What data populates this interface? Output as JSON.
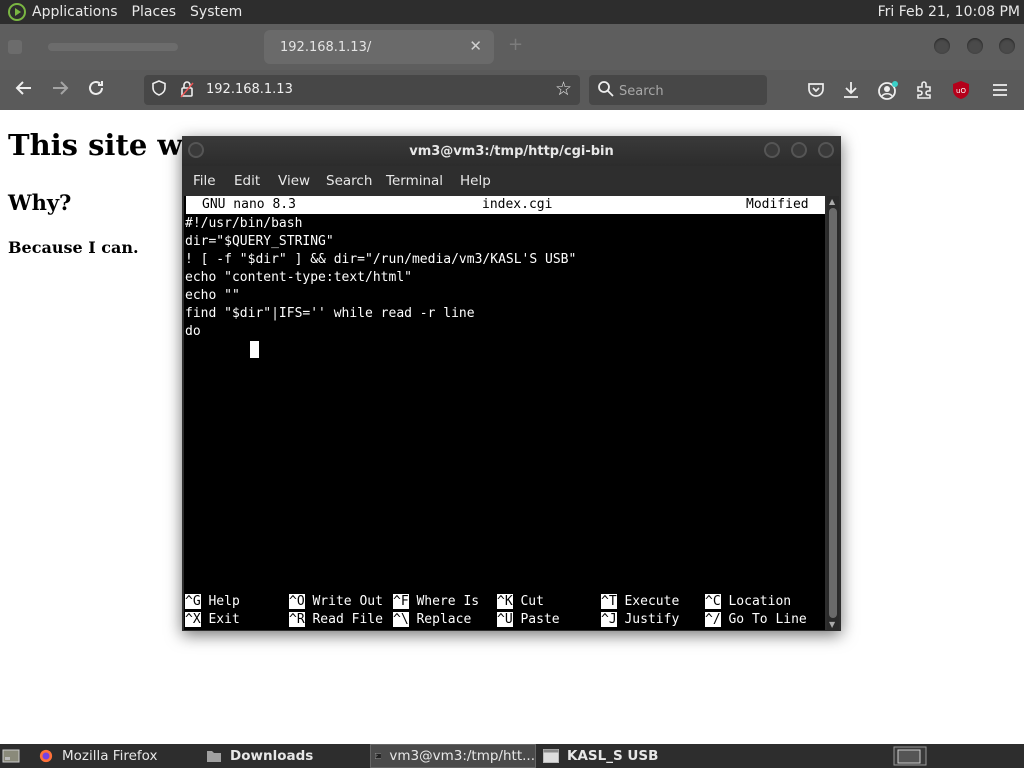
{
  "top_panel": {
    "menus": [
      "Applications",
      "Places",
      "System"
    ],
    "clock": "Fri Feb 21, 10:08 PM"
  },
  "browser": {
    "active_tab": {
      "title": "192.168.1.13/",
      "close": "✕"
    },
    "new_tab": "+",
    "url": "192.168.1.13",
    "search_placeholder": "Search",
    "icons": {
      "back": "back-arrow-icon",
      "forward": "forward-arrow-icon",
      "reload": "reload-icon",
      "star": "bookmark-star-icon",
      "pocket": "pocket-icon",
      "downloads": "download-icon",
      "account": "account-icon",
      "extensions": "extensions-icon",
      "ublock": "ublock-origin-icon",
      "menu": "hamburger-menu-icon"
    }
  },
  "page": {
    "heading": "This site was",
    "subheading": "Why?",
    "body": "Because I can."
  },
  "terminal": {
    "title": "vm3@vm3:/tmp/http/cgi-bin",
    "menu": [
      "File",
      "Edit",
      "View",
      "Search",
      "Terminal",
      "Help"
    ],
    "nano_header": {
      "version": "GNU nano 8.3",
      "file": "index.cgi",
      "status": "Modified"
    },
    "lines": [
      "#!/usr/bin/bash",
      "dir=\"$QUERY_STRING\"",
      "! [ -f \"$dir\" ] && dir=\"/run/media/vm3/KASL'S USB\"",
      "echo \"content-type:text/html\"",
      "echo \"\"",
      "find \"$dir\"|IFS='' while read -r line",
      "do"
    ],
    "shortcuts_row1": [
      {
        "key": "^G",
        "label": "Help"
      },
      {
        "key": "^O",
        "label": "Write Out"
      },
      {
        "key": "^F",
        "label": "Where Is"
      },
      {
        "key": "^K",
        "label": "Cut"
      },
      {
        "key": "^T",
        "label": "Execute"
      },
      {
        "key": "^C",
        "label": "Location"
      }
    ],
    "shortcuts_row2": [
      {
        "key": "^X",
        "label": "Exit"
      },
      {
        "key": "^R",
        "label": "Read File"
      },
      {
        "key": "^\\",
        "label": "Replace"
      },
      {
        "key": "^U",
        "label": "Paste"
      },
      {
        "key": "^J",
        "label": "Justify"
      },
      {
        "key": "^/",
        "label": "Go To Line"
      }
    ]
  },
  "taskbar": {
    "items": [
      "Mozilla Firefox",
      "Downloads",
      "vm3@vm3:/tmp/htt...",
      "KASL_S USB"
    ]
  },
  "colors": {
    "panel": "#2d2d2d",
    "firefox_toolbar": "#5a5a5a",
    "terminal_bg": "#000000",
    "mint_green": "#7ab642",
    "ublock_red": "#b5001a"
  }
}
